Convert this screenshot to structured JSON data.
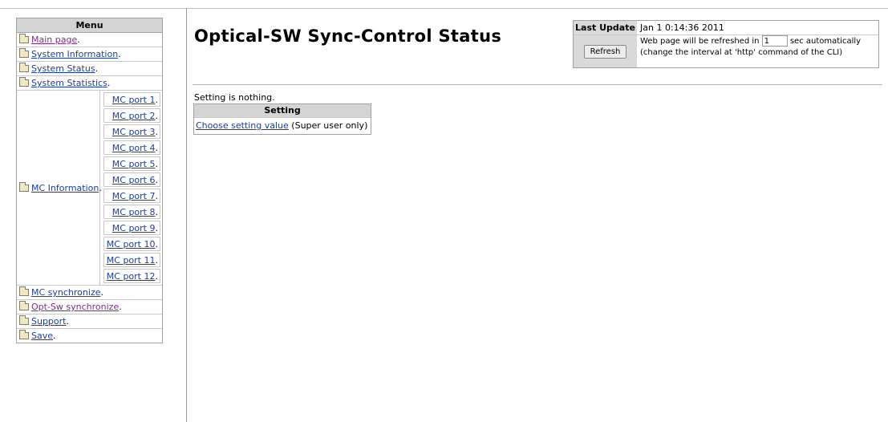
{
  "menu": {
    "header": "Menu",
    "items_top": [
      {
        "label": "Main page",
        "visited": true
      },
      {
        "label": "System Information",
        "visited": false
      },
      {
        "label": "System Status",
        "visited": false
      },
      {
        "label": "System Statistics",
        "visited": false
      }
    ],
    "mc_information": {
      "label": "MC Information",
      "ports": [
        "MC port 1",
        "MC port 2",
        "MC port 3",
        "MC port 4",
        "MC port 5",
        "MC port 6",
        "MC port 7",
        "MC port 8",
        "MC port 9",
        "MC port 10",
        "MC port 11",
        "MC port 12"
      ]
    },
    "items_bottom": [
      {
        "label": "MC synchronize",
        "visited": false
      },
      {
        "label": "Opt-Sw synchronize",
        "visited": true
      },
      {
        "label": "Support",
        "visited": false
      },
      {
        "label": "Save",
        "visited": false
      }
    ],
    "separator": "."
  },
  "page": {
    "title": "Optical-SW Sync-Control Status",
    "notice": "Setting is nothing."
  },
  "status": {
    "last_update_label": "Last Update",
    "last_update_value": "Jan 1 0:14:36 2011",
    "refresh_button": "Refresh",
    "refresh_prefix": "Web page will be refreshed in",
    "refresh_interval": "1",
    "refresh_suffix": "sec automatically",
    "refresh_hint": "(change the interval at 'http' command of the CLI)"
  },
  "setting": {
    "header": "Setting",
    "link": "Choose setting value",
    "note": "(Super user only)"
  }
}
